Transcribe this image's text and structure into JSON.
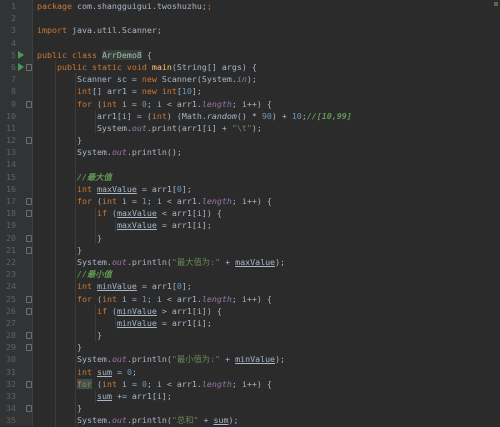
{
  "editor": {
    "lines": [
      {
        "n": "1",
        "tokens": [
          {
            "t": "package",
            "c": "kw"
          },
          {
            "t": " com.shangguigui.twoshuzhu;"
          },
          {
            "t": ";",
            "c": "kw"
          }
        ]
      },
      {
        "n": "2",
        "tokens": []
      },
      {
        "n": "3",
        "tokens": [
          {
            "t": "import",
            "c": "kw"
          },
          {
            "t": " java.util.Scanner;"
          }
        ]
      },
      {
        "n": "4",
        "tokens": []
      },
      {
        "n": "5",
        "run": true,
        "tokens": [
          {
            "t": "public class ",
            "c": "kw"
          },
          {
            "t": "ArrDemo8",
            "c": "cls"
          },
          {
            "t": " {"
          }
        ]
      },
      {
        "n": "6",
        "run": true,
        "fold": true,
        "tokens": [
          {
            "t": "    "
          },
          {
            "t": "public static void ",
            "c": "kw"
          },
          {
            "t": "main",
            "c": "fn"
          },
          {
            "t": "(String[] args) {"
          }
        ]
      },
      {
        "n": "7",
        "tokens": [
          {
            "t": "        Scanner sc = "
          },
          {
            "t": "new ",
            "c": "kw"
          },
          {
            "t": "Scanner(System."
          },
          {
            "t": "in",
            "c": "field"
          },
          {
            "t": ");"
          }
        ]
      },
      {
        "n": "8",
        "tokens": [
          {
            "t": "        "
          },
          {
            "t": "int",
            "c": "kw"
          },
          {
            "t": "[] arr1 = "
          },
          {
            "t": "new int",
            "c": "kw"
          },
          {
            "t": "["
          },
          {
            "t": "10",
            "c": "num"
          },
          {
            "t": "];"
          }
        ]
      },
      {
        "n": "9",
        "fold": true,
        "tokens": [
          {
            "t": "        "
          },
          {
            "t": "for ",
            "c": "kw"
          },
          {
            "t": "("
          },
          {
            "t": "int ",
            "c": "kw"
          },
          {
            "t": "i = "
          },
          {
            "t": "0",
            "c": "num"
          },
          {
            "t": "; i < arr1."
          },
          {
            "t": "length",
            "c": "field"
          },
          {
            "t": "; i++) {"
          }
        ]
      },
      {
        "n": "10",
        "tokens": [
          {
            "t": "            arr1[i] = ("
          },
          {
            "t": "int",
            "c": "kw"
          },
          {
            "t": ") (Math."
          },
          {
            "t": "random",
            "c": "mth"
          },
          {
            "t": "() * "
          },
          {
            "t": "90",
            "c": "num"
          },
          {
            "t": ") + "
          },
          {
            "t": "10",
            "c": "num"
          },
          {
            "t": ";"
          },
          {
            "t": "//[10,99]",
            "c": "cmt"
          }
        ]
      },
      {
        "n": "11",
        "tokens": [
          {
            "t": "            System."
          },
          {
            "t": "out",
            "c": "field"
          },
          {
            "t": ".print(arr1[i] + "
          },
          {
            "t": "\"\\t\"",
            "c": "str"
          },
          {
            "t": ");"
          }
        ]
      },
      {
        "n": "12",
        "fold": true,
        "tokens": [
          {
            "t": "        }"
          }
        ]
      },
      {
        "n": "13",
        "tokens": [
          {
            "t": "        System."
          },
          {
            "t": "out",
            "c": "field"
          },
          {
            "t": ".println();"
          }
        ]
      },
      {
        "n": "14",
        "tokens": []
      },
      {
        "n": "15",
        "tokens": [
          {
            "t": "        "
          },
          {
            "t": "//最大值",
            "c": "cmt"
          }
        ]
      },
      {
        "n": "16",
        "tokens": [
          {
            "t": "        "
          },
          {
            "t": "int ",
            "c": "kw"
          },
          {
            "t": "maxValue",
            "c": "u"
          },
          {
            "t": " = arr1["
          },
          {
            "t": "0",
            "c": "num"
          },
          {
            "t": "];"
          }
        ]
      },
      {
        "n": "17",
        "fold": true,
        "tokens": [
          {
            "t": "        "
          },
          {
            "t": "for ",
            "c": "kw"
          },
          {
            "t": "("
          },
          {
            "t": "int ",
            "c": "kw"
          },
          {
            "t": "i = "
          },
          {
            "t": "1",
            "c": "num"
          },
          {
            "t": "; i < arr1."
          },
          {
            "t": "length",
            "c": "field"
          },
          {
            "t": "; i++) {"
          }
        ]
      },
      {
        "n": "18",
        "fold": true,
        "tokens": [
          {
            "t": "            "
          },
          {
            "t": "if ",
            "c": "kw"
          },
          {
            "t": "("
          },
          {
            "t": "maxValue",
            "c": "u"
          },
          {
            "t": " < arr1[i]) {"
          }
        ]
      },
      {
        "n": "19",
        "tokens": [
          {
            "t": "                "
          },
          {
            "t": "maxValue",
            "c": "u"
          },
          {
            "t": " = arr1[i];"
          }
        ]
      },
      {
        "n": "20",
        "fold": true,
        "tokens": [
          {
            "t": "            }"
          }
        ]
      },
      {
        "n": "21",
        "fold": true,
        "tokens": [
          {
            "t": "        }"
          }
        ]
      },
      {
        "n": "22",
        "tokens": [
          {
            "t": "        System."
          },
          {
            "t": "out",
            "c": "field"
          },
          {
            "t": ".println("
          },
          {
            "t": "\"最大值为:\"",
            "c": "str"
          },
          {
            "t": " + "
          },
          {
            "t": "maxValue",
            "c": "u"
          },
          {
            "t": ");"
          }
        ]
      },
      {
        "n": "23",
        "tokens": [
          {
            "t": "        "
          },
          {
            "t": "//最小值",
            "c": "cmt"
          }
        ]
      },
      {
        "n": "24",
        "tokens": [
          {
            "t": "        "
          },
          {
            "t": "int ",
            "c": "kw"
          },
          {
            "t": "minValue",
            "c": "u"
          },
          {
            "t": " = arr1["
          },
          {
            "t": "0",
            "c": "num"
          },
          {
            "t": "];"
          }
        ]
      },
      {
        "n": "25",
        "fold": true,
        "tokens": [
          {
            "t": "        "
          },
          {
            "t": "for ",
            "c": "kw"
          },
          {
            "t": "("
          },
          {
            "t": "int ",
            "c": "kw"
          },
          {
            "t": "i = "
          },
          {
            "t": "1",
            "c": "num"
          },
          {
            "t": "; i < arr1."
          },
          {
            "t": "length",
            "c": "field"
          },
          {
            "t": "; i++) {"
          }
        ]
      },
      {
        "n": "26",
        "fold": true,
        "tokens": [
          {
            "t": "            "
          },
          {
            "t": "if ",
            "c": "kw"
          },
          {
            "t": "("
          },
          {
            "t": "minValue",
            "c": "u"
          },
          {
            "t": " > arr1[i]) {"
          }
        ]
      },
      {
        "n": "27",
        "tokens": [
          {
            "t": "                "
          },
          {
            "t": "minValue",
            "c": "u"
          },
          {
            "t": " = arr1[i];"
          }
        ]
      },
      {
        "n": "28",
        "fold": true,
        "tokens": [
          {
            "t": "            }"
          }
        ]
      },
      {
        "n": "29",
        "fold": true,
        "tokens": [
          {
            "t": "        }"
          }
        ]
      },
      {
        "n": "30",
        "tokens": [
          {
            "t": "        System."
          },
          {
            "t": "out",
            "c": "field"
          },
          {
            "t": ".println("
          },
          {
            "t": "\"最小值为:\"",
            "c": "str"
          },
          {
            "t": " + "
          },
          {
            "t": "minValue",
            "c": "u"
          },
          {
            "t": ");"
          }
        ]
      },
      {
        "n": "31",
        "tokens": [
          {
            "t": "        "
          },
          {
            "t": "int ",
            "c": "kw"
          },
          {
            "t": "sum",
            "c": "u"
          },
          {
            "t": " = "
          },
          {
            "t": "0",
            "c": "num"
          },
          {
            "t": ";"
          }
        ]
      },
      {
        "n": "32",
        "fold": true,
        "tokens": [
          {
            "t": "        "
          },
          {
            "t": "for",
            "c": "kw hl"
          },
          {
            "t": " ("
          },
          {
            "t": "int ",
            "c": "kw"
          },
          {
            "t": "i = "
          },
          {
            "t": "0",
            "c": "num"
          },
          {
            "t": "; i < arr1."
          },
          {
            "t": "length",
            "c": "field"
          },
          {
            "t": "; i++) {"
          }
        ]
      },
      {
        "n": "33",
        "tokens": [
          {
            "t": "            "
          },
          {
            "t": "sum",
            "c": "u"
          },
          {
            "t": " += arr1[i];"
          }
        ]
      },
      {
        "n": "34",
        "fold": true,
        "tokens": [
          {
            "t": "        }"
          }
        ]
      },
      {
        "n": "35",
        "tokens": [
          {
            "t": "        System."
          },
          {
            "t": "out",
            "c": "field"
          },
          {
            "t": ".println("
          },
          {
            "t": "\"总和\"",
            "c": "str"
          },
          {
            "t": " + "
          },
          {
            "t": "sum",
            "c": "u"
          },
          {
            "t": ");"
          }
        ]
      }
    ]
  }
}
